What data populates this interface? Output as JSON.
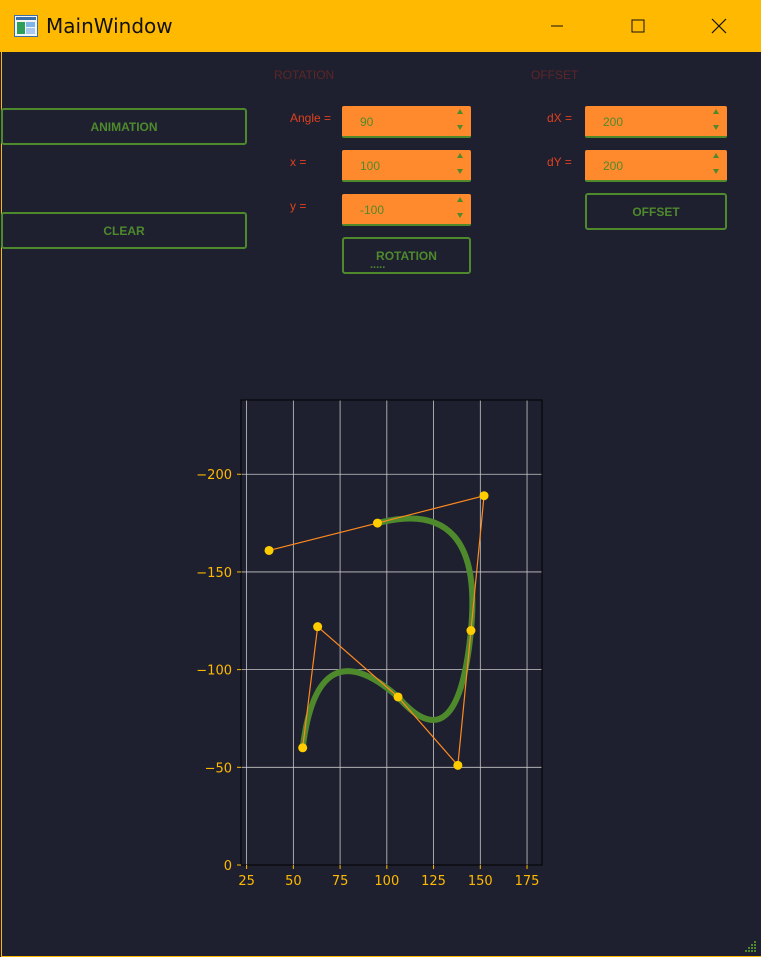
{
  "window": {
    "title": "MainWindow",
    "title_bar_color": "#ffb900"
  },
  "buttons": {
    "animation": "ANIMATION",
    "clear": "CLEAR",
    "rotation": "ROTATION",
    "offset": "OFFSET"
  },
  "groups": {
    "rotation": "ROTATION",
    "offset": "OFFSET"
  },
  "rotation": {
    "angle_label": "Angle =",
    "angle_value": "90",
    "x_label": "x =",
    "x_value": "100",
    "y_label": "y =",
    "y_value": "-100"
  },
  "offset": {
    "dx_label": "dX =",
    "dx_value": "200",
    "dy_label": "dY =",
    "dy_value": "200"
  },
  "status_text": ".....",
  "colors": {
    "accent": "#4e8a2c",
    "spinbox": "#fe8a2d",
    "label": "#e0401e",
    "points": "#ffcc00",
    "polyline": "#ff8a1e",
    "background": "#1e2030"
  },
  "chart_data": {
    "type": "line",
    "xlim": [
      22,
      183
    ],
    "ylim": [
      0,
      -238
    ],
    "y_inverted": true,
    "grid": true,
    "x_ticks": [
      25,
      50,
      75,
      100,
      125,
      150,
      175
    ],
    "y_ticks": [
      0,
      -50,
      -100,
      -150,
      -200
    ],
    "x_tick_labels": [
      "25",
      "50",
      "75",
      "100",
      "125",
      "150",
      "175"
    ],
    "y_tick_labels": [
      "0",
      "−50",
      "−100",
      "−150",
      "−200"
    ],
    "series": [
      {
        "style": "control-polygon",
        "x": [
          37,
          95,
          152,
          145,
          138,
          106,
          63,
          55
        ],
        "y": [
          -161,
          -175,
          -189,
          -120,
          -51,
          -86,
          -122,
          -60
        ]
      },
      {
        "style": "bezier-curve",
        "segments": [
          [
            [
              55,
              -60
            ],
            [
              63,
              -122
            ],
            [
              106,
              -86
            ]
          ],
          [
            [
              106,
              -86
            ],
            [
              138,
              -51
            ],
            [
              145,
              -120
            ]
          ],
          [
            [
              145,
              -120
            ],
            [
              152,
              -189
            ],
            [
              95,
              -175
            ]
          ]
        ]
      }
    ]
  }
}
